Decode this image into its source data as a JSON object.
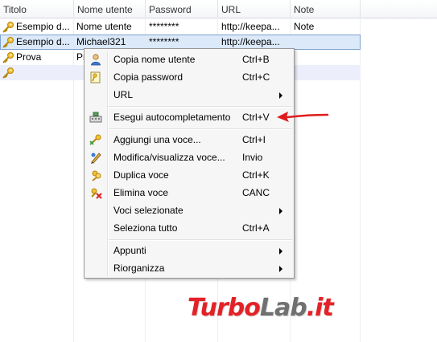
{
  "columns": [
    "Titolo",
    "Nome utente",
    "Password",
    "URL",
    "Note"
  ],
  "rows": [
    {
      "title": "Esempio d...",
      "user": "Nome utente",
      "password": "********",
      "url": "http://keepa...",
      "notes": "Note"
    },
    {
      "title": "Esempio d...",
      "user": "Michael321",
      "password": "********",
      "url": "http://keepa...",
      "notes": ""
    },
    {
      "title": "Prova",
      "user": "Pr",
      "password": "",
      "url": "",
      "notes": ""
    }
  ],
  "menu": {
    "copy_user": {
      "label": "Copia nome utente",
      "shortcut": "Ctrl+B"
    },
    "copy_password": {
      "label": "Copia password",
      "shortcut": "Ctrl+C"
    },
    "url": {
      "label": "URL"
    },
    "autotype": {
      "label": "Esegui autocompletamento",
      "shortcut": "Ctrl+V"
    },
    "add_entry": {
      "label": "Aggiungi una voce...",
      "shortcut": "Ctrl+I"
    },
    "edit_entry": {
      "label": "Modifica/visualizza voce...",
      "shortcut": "Invio"
    },
    "duplicate": {
      "label": "Duplica voce",
      "shortcut": "Ctrl+K"
    },
    "delete": {
      "label": "Elimina voce",
      "shortcut": "CANC"
    },
    "selected": {
      "label": "Voci selezionate"
    },
    "select_all": {
      "label": "Seleziona tutto",
      "shortcut": "Ctrl+A"
    },
    "notes": {
      "label": "Appunti"
    },
    "reorganize": {
      "label": "Riorganizza"
    }
  },
  "watermark": {
    "part1": "Turbo",
    "part2": "Lab",
    "part3": ".it"
  },
  "colors": {
    "selection": "#dbe9f9",
    "selection_border": "#7da2ce",
    "arrow": "#e01b1b",
    "logo_red": "#e32228",
    "logo_grey": "#707070"
  },
  "icons": [
    "key-icon",
    "user-icon",
    "password-icon",
    "keyboard-icon",
    "add-entry-icon",
    "edit-entry-icon",
    "duplicate-icon",
    "delete-icon",
    "submenu-arrow-icon"
  ]
}
